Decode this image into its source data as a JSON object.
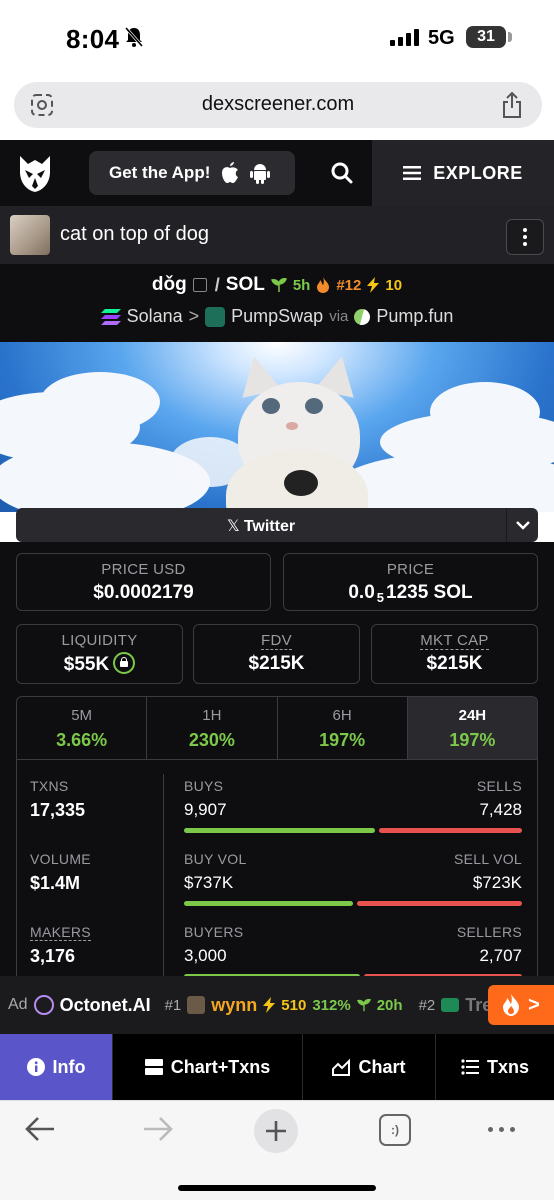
{
  "status_bar": {
    "time": "8:04",
    "network": "5G",
    "battery": "31"
  },
  "browser": {
    "url": "dexscreener.com"
  },
  "header": {
    "get_app": "Get the App!",
    "explore": "EXPLORE"
  },
  "token": {
    "name": "cat on top of dog"
  },
  "pair": {
    "base": "dǒg",
    "separator": "/",
    "quote": "SOL",
    "age": "5h",
    "rank": "#12",
    "boosts": "10",
    "chain": "Solana",
    "dex": "PumpSwap",
    "via": "via",
    "launchpad": "Pump.fun"
  },
  "socials": {
    "twitter": "Twitter"
  },
  "price": {
    "usd_label": "PRICE USD",
    "usd_value": "$0.0002179",
    "native_label": "PRICE",
    "native_prefix": "0.0",
    "native_sub": "5",
    "native_suffix": "1235 SOL"
  },
  "metrics": {
    "liquidity_label": "LIQUIDITY",
    "liquidity_value": "$55K",
    "fdv_label": "FDV",
    "fdv_value": "$215K",
    "mktcap_label": "MKT CAP",
    "mktcap_value": "$215K"
  },
  "timeframes": [
    {
      "label": "5M",
      "value": "3.66%"
    },
    {
      "label": "1H",
      "value": "230%"
    },
    {
      "label": "6H",
      "value": "197%"
    },
    {
      "label": "24H",
      "value": "197%"
    }
  ],
  "stats": {
    "txns_label": "TXNS",
    "txns_value": "17,335",
    "volume_label": "VOLUME",
    "volume_value": "$1.4M",
    "makers_label": "MAKERS",
    "makers_value": "3,176",
    "buys_label": "BUYS",
    "buys_value": "9,907",
    "sells_label": "SELLS",
    "sells_value": "7,428",
    "buy_vol_label": "BUY VOL",
    "buy_vol_value": "$737K",
    "sell_vol_label": "SELL VOL",
    "sell_vol_value": "$723K",
    "buyers_label": "BUYERS",
    "buyers_value": "3,000",
    "sellers_label": "SELLERS",
    "sellers_value": "2,707",
    "buy_share_txns": 0.571,
    "buy_share_volume": 0.505,
    "buy_share_makers": 0.526
  },
  "ticker": {
    "ad_label": "Ad",
    "ad_name": "Octonet.AI",
    "item1_rank": "#1",
    "item1_name": "wynn",
    "item1_boosts": "510",
    "item1_change": "312%",
    "item1_age": "20h",
    "item2_rank": "#2",
    "item2_name": "Tre"
  },
  "tabs": [
    {
      "label": "Info",
      "active": true
    },
    {
      "label": "Chart+Txns",
      "active": false
    },
    {
      "label": "Chart",
      "active": false
    },
    {
      "label": "Txns",
      "active": false
    }
  ],
  "colors": {
    "accent_green": "#7cc94a",
    "accent_red": "#e8534f",
    "active_tab": "#5a55c9",
    "hot_orange": "#ff6a1a"
  }
}
